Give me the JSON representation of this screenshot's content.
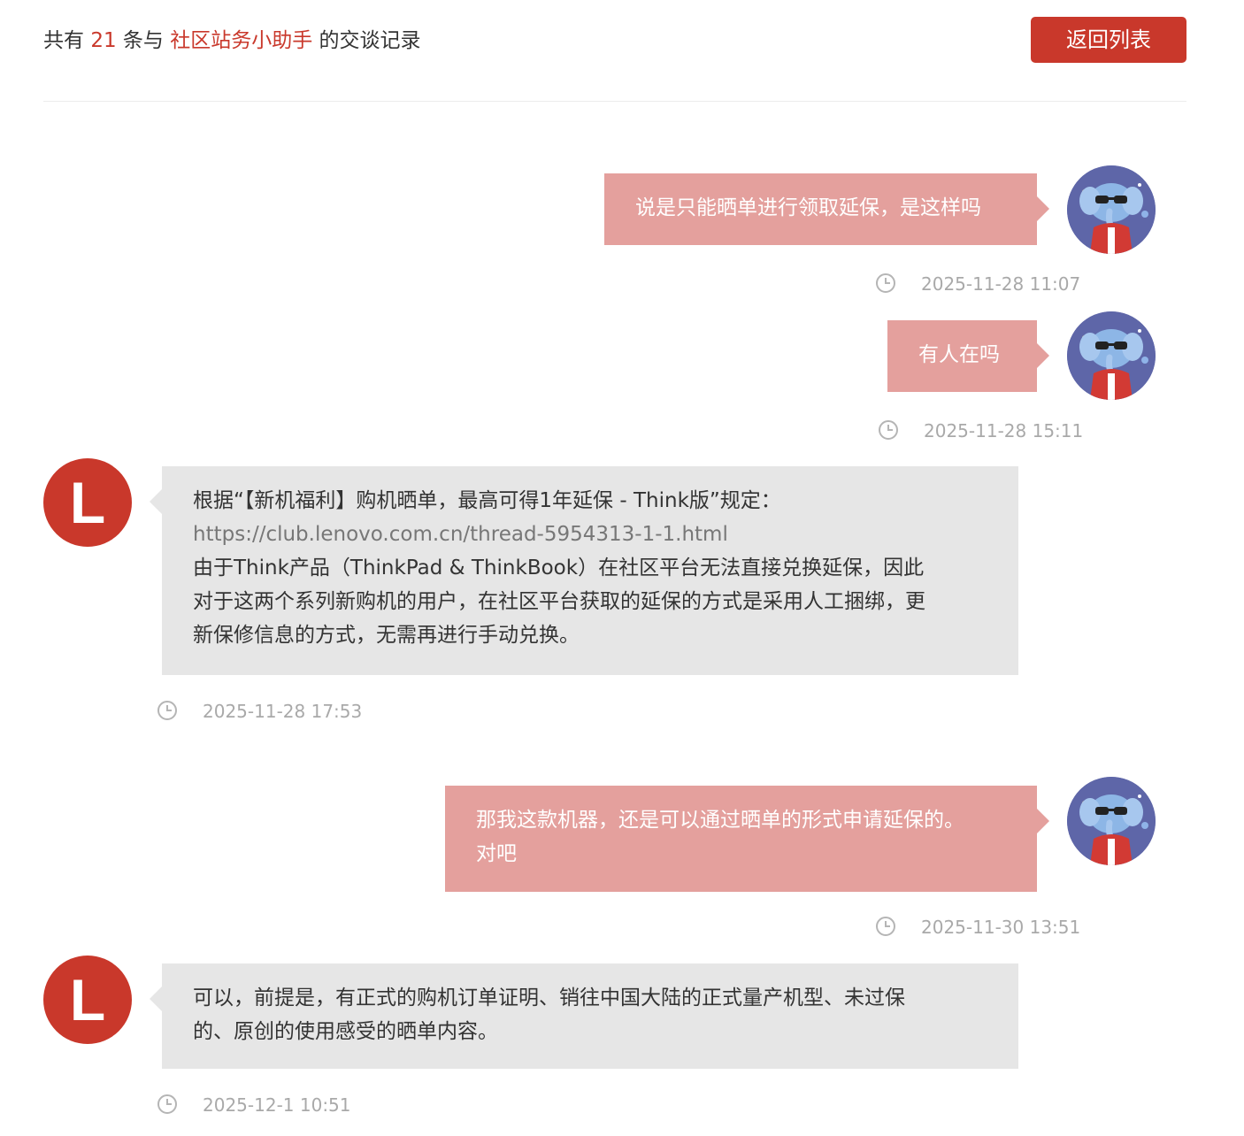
{
  "header": {
    "prefix": "共有",
    "count": "21",
    "middle": "条与",
    "contact": "社区站务小助手",
    "suffix": "的交谈记录",
    "back_button": "返回列表"
  },
  "messages": [
    {
      "side": "user",
      "lines": [
        "说是只能晒单进行领取延保，是这样吗"
      ],
      "time": "2025-11-28 11:07"
    },
    {
      "side": "user",
      "lines": [
        "有人在吗"
      ],
      "time": "2025-11-28 15:11"
    },
    {
      "side": "bot",
      "lines": [
        "根据“【新机福利】购机晒单，最高可得1年延保 - Think版”规定：",
        "https://club.lenovo.com.cn/thread-5954313-1-1.html",
        "由于Think产品（ThinkPad & ThinkBook）在社区平台无法直接兑换延保，因此",
        "对于这两个系列新购机的用户，在社区平台获取的延保的方式是采用人工捆绑，更",
        "新保修信息的方式，无需再进行手动兑换。"
      ],
      "time": "2025-11-28 17:53"
    },
    {
      "side": "user",
      "lines": [
        "那我这款机器，还是可以通过晒单的形式申请延保的。",
        "对吧"
      ],
      "time": "2025-11-30 13:51"
    },
    {
      "side": "bot",
      "lines": [
        "可以，前提是，有正式的购机订单证明、销往中国大陆的正式量产机型、未过保",
        "的、原创的使用感受的晒单内容。"
      ],
      "time": "2025-12-1 10:51"
    }
  ],
  "bot_avatar_letter": "L",
  "colors": {
    "accent": "#c9382b",
    "user_bubble": "#e4a09d",
    "bot_bubble": "#e6e6e6",
    "time": "#a9a9a9"
  },
  "icons": {
    "clock": "clock-icon",
    "user_avatar": "elephant-avatar-icon"
  }
}
